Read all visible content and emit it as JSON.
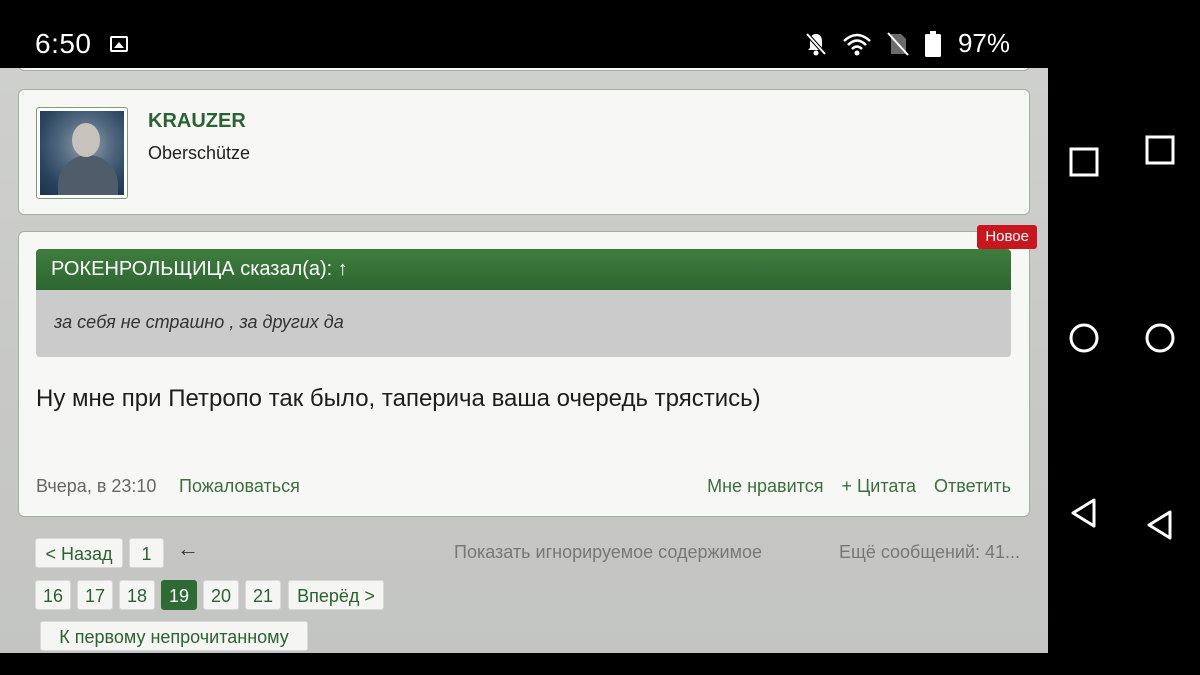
{
  "status_bar": {
    "time": "6:50",
    "battery": "97%",
    "icons": [
      "image-icon",
      "mute-icon",
      "wifi-icon",
      "no-sim-icon",
      "battery-icon"
    ]
  },
  "user": {
    "name": "KRAUZER",
    "title": "Oberschütze"
  },
  "post": {
    "badge": "Новое",
    "quote_author": "РОКЕНРОЛЬЩИЦА сказал(а): ↑",
    "quote_text": "за себя не страшно , за других да",
    "text": "Ну мне при Петропо так было, таперича ваша очередь трястись)",
    "date": "Вчера, в 23:10",
    "report": "Пожаловаться",
    "like": "Мне нравится",
    "quote_action": "+ Цитата",
    "reply": "Ответить"
  },
  "pagination": {
    "prev": "< Назад",
    "first": "1",
    "arrow": "←",
    "show_ignored": "Показать игнорируемое содержимое",
    "more_messages": "Ещё сообщений: 41...",
    "pages": [
      "16",
      "17",
      "18",
      "19",
      "20",
      "21"
    ],
    "current_page": "19",
    "next": "Вперёд >",
    "first_unread": "К первому непрочитанному"
  },
  "colors": {
    "accent_green": "#2e6a33",
    "badge_red": "#c8161e"
  }
}
